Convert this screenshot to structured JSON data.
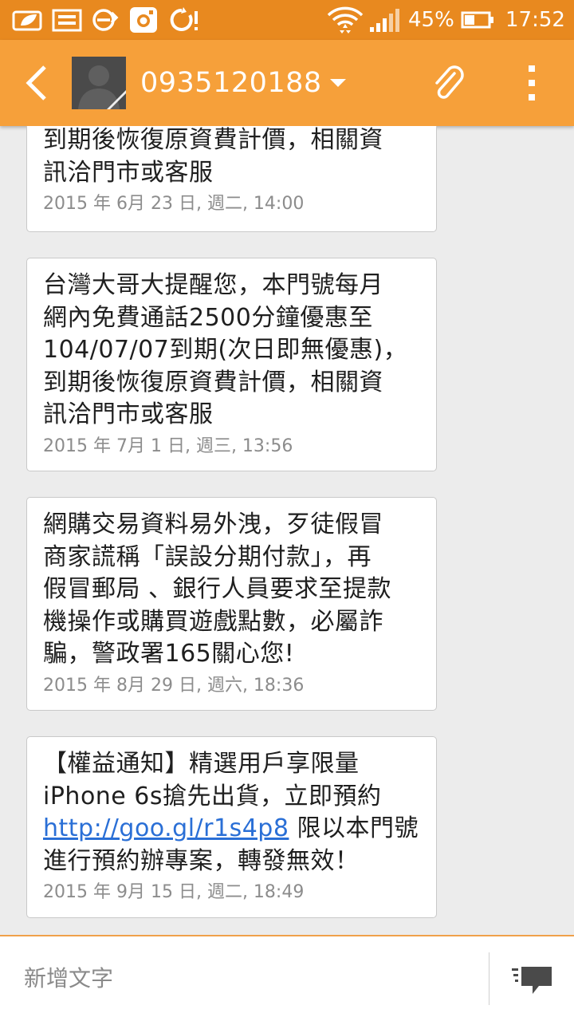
{
  "status_bar": {
    "battery": "45%",
    "time": "17:52"
  },
  "header": {
    "contact": "0935120188"
  },
  "messages": [
    {
      "text": "到期後恢復原資費計價，相關資\n訊洽門市或客服",
      "time": "2015 年 6月 23 日, 週二, 14:00"
    },
    {
      "text": "台灣大哥大提醒您，本門號每月\n網內免費通話2500分鐘優惠至\n104/07/07到期(次日即無優惠)，\n到期後恢復原資費計價，相關資\n訊洽門市或客服",
      "time": "2015 年 7月 1 日, 週三, 13:56"
    },
    {
      "text": "網購交易資料易外洩，歹徒假冒\n商家謊稱「誤設分期付款」，再\n假冒郵局 、銀行人員要求至提款\n機操作或購買遊戲點數，必屬詐\n騙，警政署165關心您!",
      "time": "2015 年 8月 29 日, 週六, 18:36"
    },
    {
      "text_before_link": "【權益通知】精選用戶享限量\niPhone 6s搶先出貨，立即預約\n",
      "link": "http://goo.gl/r1s4p8",
      "text_after_link": " 限以本門號\n進行預約辦專案，轉發無效！",
      "time": "2015 年 9月 15 日, 週二, 18:49"
    }
  ],
  "composer": {
    "placeholder": "新增文字"
  },
  "colors": {
    "status_bar": "#e8891f",
    "app_bar": "#f6a03a",
    "background": "#ececec",
    "link": "#2a6fd6"
  }
}
